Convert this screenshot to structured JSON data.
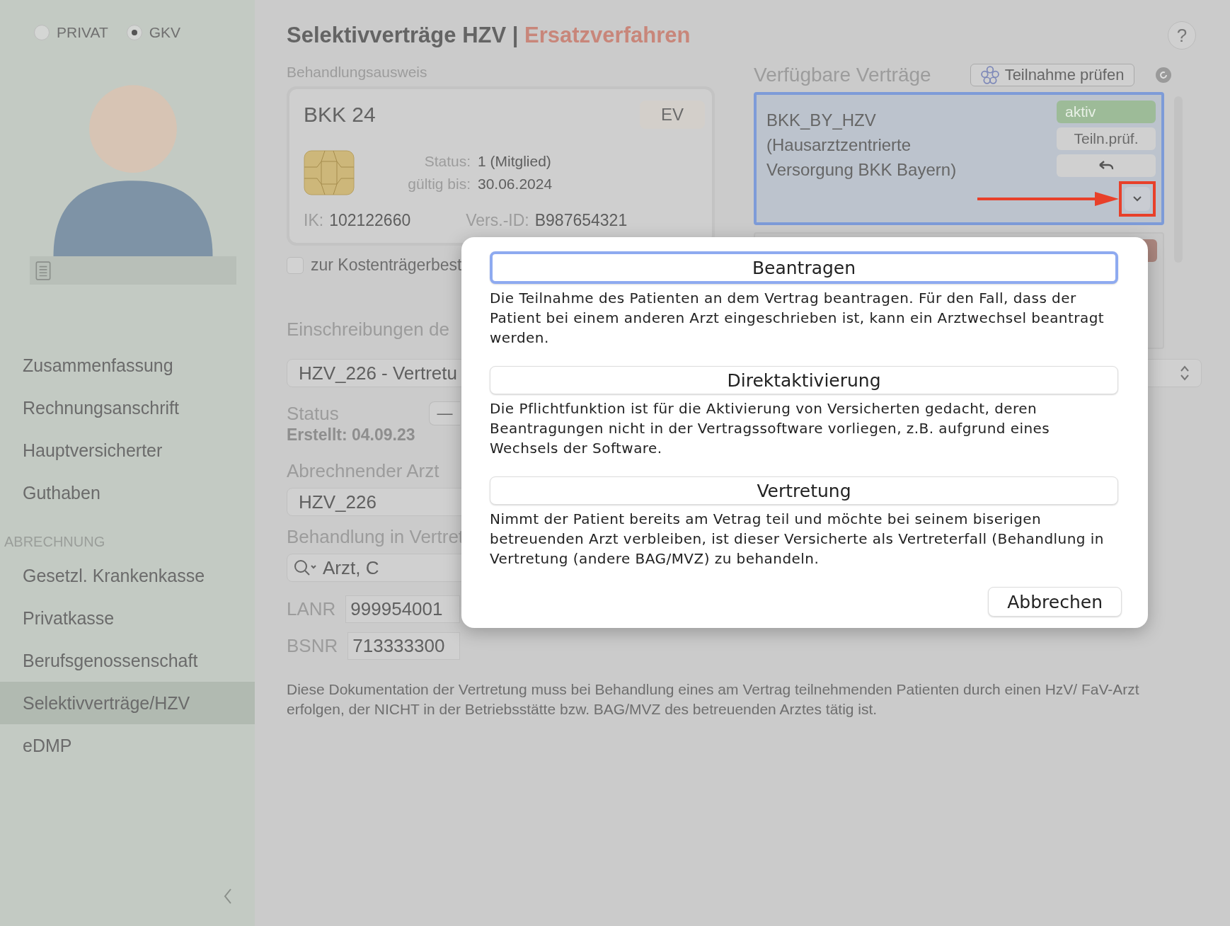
{
  "sidebar": {
    "insurance_type": [
      {
        "label": "PRIVAT",
        "selected": false
      },
      {
        "label": "GKV",
        "selected": true
      }
    ],
    "nav_items": [
      {
        "label": "Zusammenfassung",
        "selected": false
      },
      {
        "label": "Rechnungsanschrift",
        "selected": false
      },
      {
        "label": "Hauptversicherter",
        "selected": false
      },
      {
        "label": "Guthaben",
        "selected": false
      }
    ],
    "section_header": "ABRECHNUNG",
    "billing_items": [
      {
        "label": "Gesetzl. Krankenkasse",
        "selected": false
      },
      {
        "label": "Privatkasse",
        "selected": false
      },
      {
        "label": "Berufsgenossenschaft",
        "selected": false
      },
      {
        "label": "Selektivverträge/HZV",
        "selected": true
      },
      {
        "label": "eDMP",
        "selected": false
      }
    ]
  },
  "header": {
    "title": "Selektivverträge HZV",
    "separator": "|",
    "mode": "Ersatzverfahren",
    "help": "?"
  },
  "card": {
    "label": "Behandlungsausweis",
    "insurer": "BKK 24",
    "badge": "EV",
    "fields": [
      {
        "label": "Status:",
        "value": "1 (Mitglied)"
      },
      {
        "label": "gültig bis:",
        "value": "30.06.2024"
      }
    ],
    "ik_label": "IK:",
    "ik": "102122660",
    "id_label": "Vers.-ID:",
    "id": "B987654321"
  },
  "cost_checkbox": {
    "label": "zur Kostenträgerbest",
    "checked": false
  },
  "contracts": {
    "heading": "Verfügbare Verträge",
    "check_button": "Teilnahme prüfen",
    "items": [
      {
        "name": "BKK_BY_HZV (Hausarztzentrierte Versorgung BKK Bayern)",
        "selected": true,
        "status": "aktiv",
        "color": "#9dbb98",
        "check_button": "Teiln.prüf."
      },
      {
        "selected": false,
        "color": "#ab867e"
      }
    ]
  },
  "enrolment": {
    "heading": "Einschreibungen de",
    "contract_select": "HZV_226 - Vertretu",
    "status_label": "Status",
    "status_button": "—",
    "created": "Erstellt: 04.09.23",
    "doctor_label": "Abrechnender Arzt",
    "doctor_select": "HZV_226",
    "substitute_label": "Behandlung in Vertret",
    "substitute_search": "Arzt, C",
    "lanr_label": "LANR",
    "lanr": "999954001",
    "bsnr_label": "BSNR",
    "bsnr": "713333300"
  },
  "note": "Diese Dokumentation der Vertretung muss bei Behandlung eines am Vertrag teilnehmenden Patienten durch einen HzV/ FaV-Arzt erfolgen, der NICHT in der Betriebsstätte bzw. BAG/MVZ des betreuenden Arztes tätig ist.",
  "dialog": {
    "options": [
      {
        "label": "Beantragen",
        "selected": true,
        "description": "Die Teilnahme des Patienten an dem Vertrag beantragen. Für den Fall, dass der Patient bei einem anderen Arzt eingeschrieben ist, kann ein Arztwechsel beantragt werden."
      },
      {
        "label": "Direktaktivierung",
        "selected": false,
        "description": "Die Pflichtfunktion ist für die Aktivierung von Versicherten gedacht, deren Beantragungen nicht in der Vertragssoftware vorliegen, z.B. aufgrund eines Wechsels der Software."
      },
      {
        "label": "Vertretung",
        "selected": false,
        "description": "Nimmt der Patient bereits am Vetrag teil und möchte bei seinem biserigen betreuenden Arzt verbleiben, ist dieser Versicherte als Vertreterfall (Behandlung in Vertretung (andere BAG/MVZ) zu behandeln."
      }
    ],
    "cancel_button": "Abbrechen"
  }
}
